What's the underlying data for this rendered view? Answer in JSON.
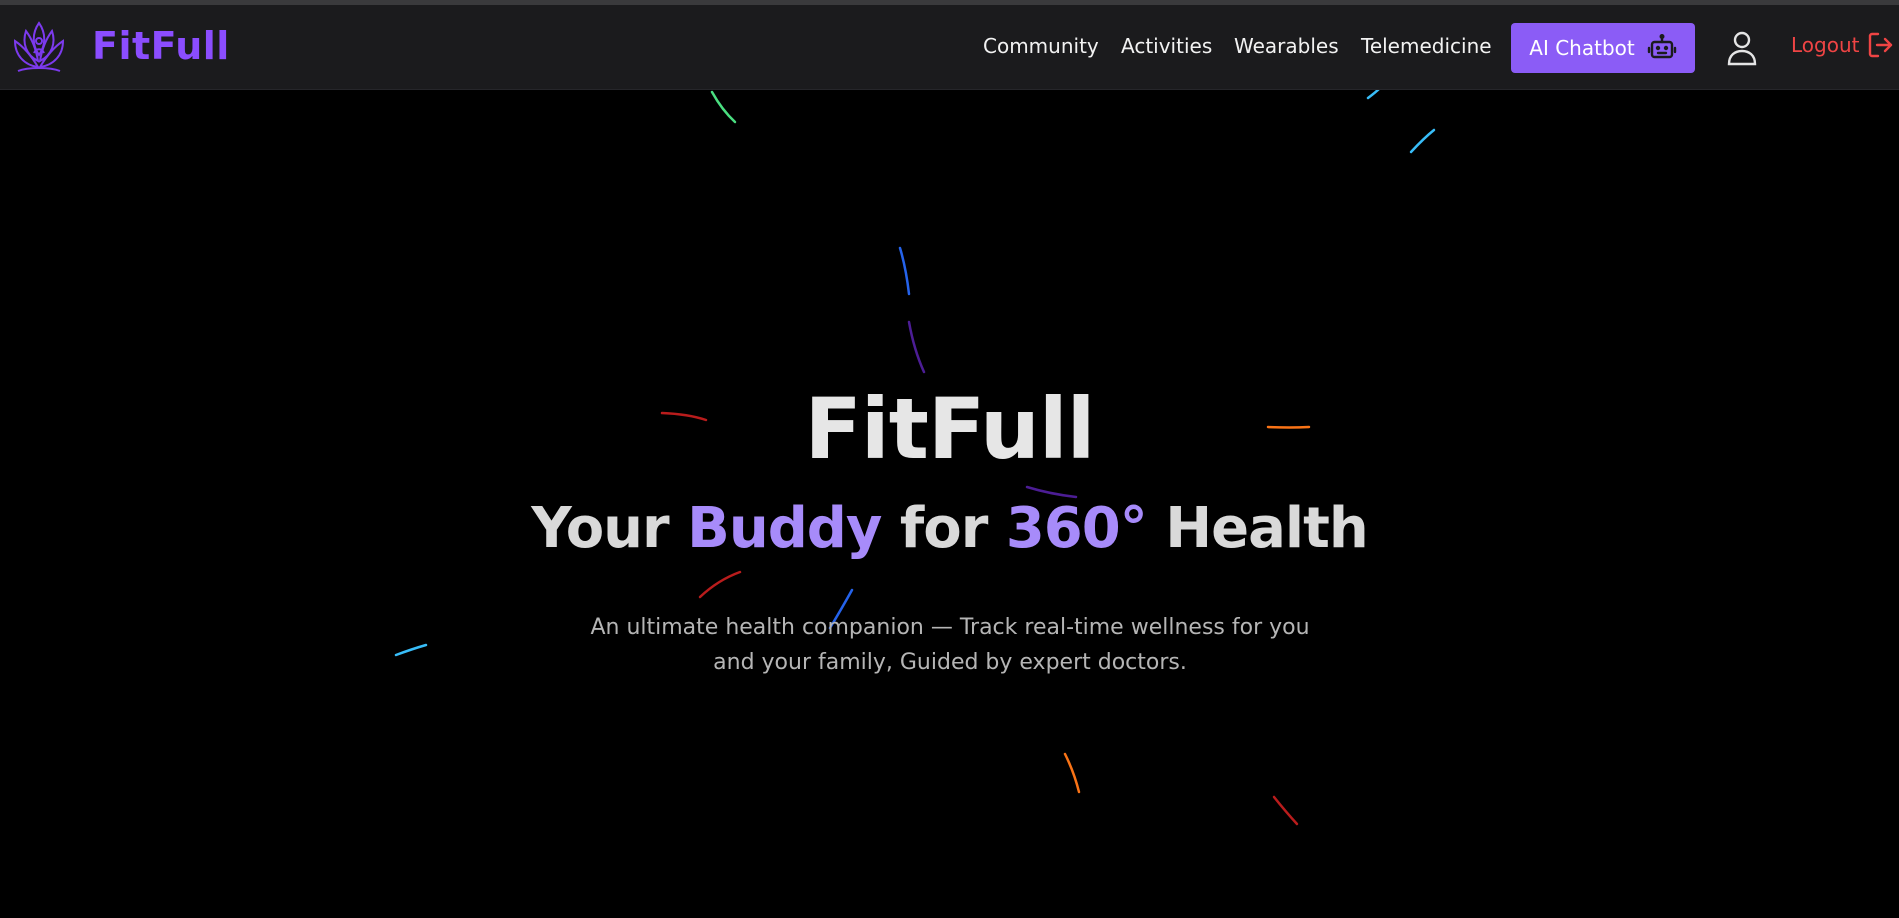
{
  "brand": {
    "name": "FitFull",
    "logo_icon": "lotus-meditation-icon"
  },
  "nav": {
    "links": [
      "Community",
      "Activities",
      "Wearables",
      "Telemedicine"
    ],
    "chatbot": {
      "label": "AI Chatbot",
      "icon": "robot-icon"
    },
    "profile_icon": "user-icon",
    "logout": {
      "label": "Logout",
      "icon": "logout-icon"
    }
  },
  "hero": {
    "title": "FitFull",
    "subtitle": {
      "part1": "Your ",
      "accent1": "Buddy",
      "part2": " for ",
      "accent2": "360°",
      "part3": " Health"
    },
    "description": "An ultimate health companion — Track real-time wellness for you and your family, Guided by expert doctors."
  },
  "colors": {
    "background": "#000000",
    "navbar": "#1b1b1d",
    "brand": "#8b4dff",
    "accent": "#a78bfa",
    "button": "#8b5cf6",
    "logout": "#ef4444"
  }
}
